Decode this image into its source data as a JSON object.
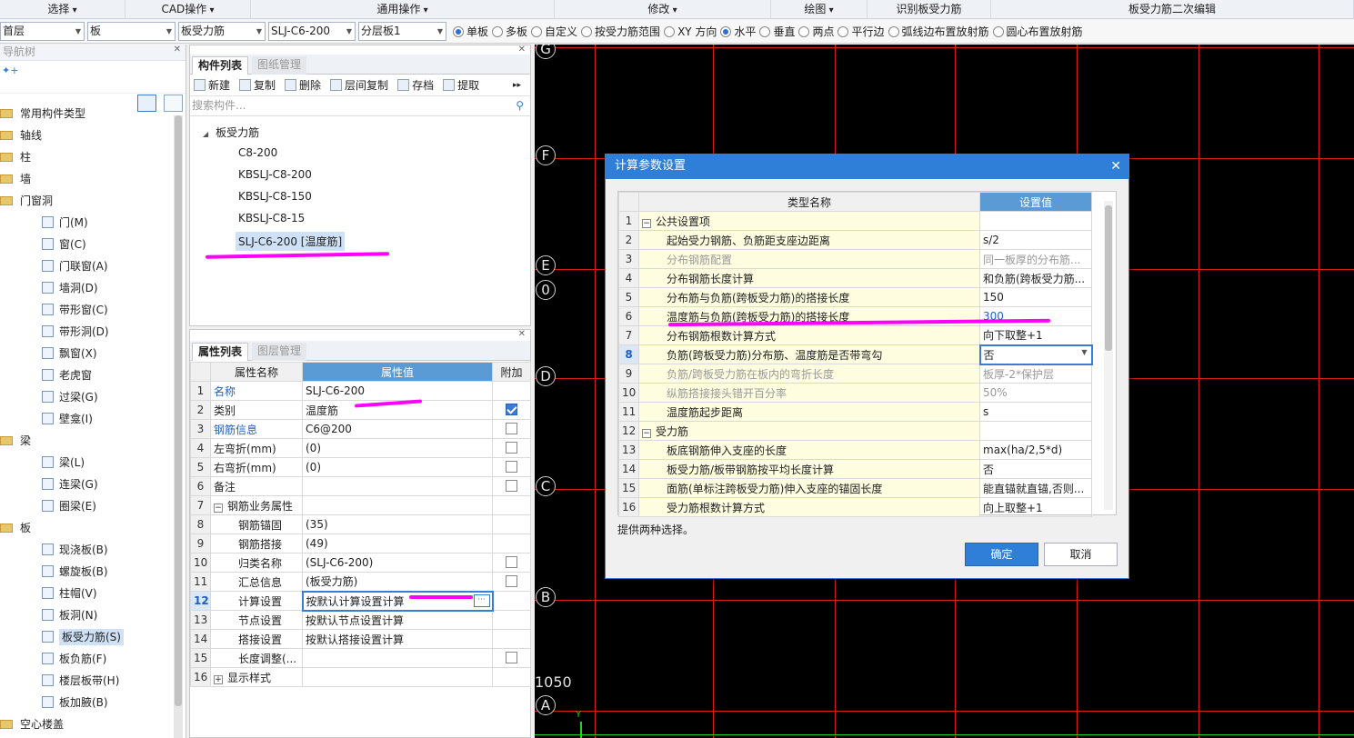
{
  "menu": [
    {
      "label": "选择",
      "w": 138
    },
    {
      "label": "CAD操作",
      "w": 138
    },
    {
      "label": "通用操作",
      "w": 334
    },
    {
      "label": "修改",
      "w": 238
    },
    {
      "label": "绘图",
      "w": 106
    },
    {
      "label": "识别板受力筋",
      "w": 136
    },
    {
      "label": "板受力筋二次编辑",
      "w": 399
    }
  ],
  "options": {
    "combos": [
      {
        "v": "首层",
        "w": 93
      },
      {
        "v": "板",
        "w": 97
      },
      {
        "v": "板受力筋",
        "w": 96
      },
      {
        "v": "SLJ-C6-200",
        "w": 96
      },
      {
        "v": "分层板1",
        "w": 97
      }
    ],
    "radios": [
      {
        "label": "单板",
        "on": true
      },
      {
        "label": "多板",
        "on": false
      },
      {
        "label": "自定义",
        "on": false
      },
      {
        "label": "按受力筋范围",
        "on": false
      },
      {
        "label": "XY 方向",
        "on": false
      },
      {
        "label": "水平",
        "on": true
      },
      {
        "label": "垂直",
        "on": false
      },
      {
        "label": "两点",
        "on": false
      },
      {
        "label": "平行边",
        "on": false
      },
      {
        "label": "弧线边布置放射筋",
        "on": false
      },
      {
        "label": "圆心布置放射筋",
        "on": false
      }
    ]
  },
  "nav": {
    "title": "导航树",
    "items": [
      {
        "label": "常用构件类型",
        "lvl": 0,
        "folder": true
      },
      {
        "label": "轴线",
        "lvl": 0,
        "folder": true
      },
      {
        "label": "柱",
        "lvl": 0,
        "folder": true
      },
      {
        "label": "墙",
        "lvl": 0,
        "folder": true
      },
      {
        "label": "门窗洞",
        "lvl": 0,
        "folder": true
      },
      {
        "label": "门(M)",
        "lvl": 1
      },
      {
        "label": "窗(C)",
        "lvl": 1
      },
      {
        "label": "门联窗(A)",
        "lvl": 1
      },
      {
        "label": "墙洞(D)",
        "lvl": 1
      },
      {
        "label": "带形窗(C)",
        "lvl": 1
      },
      {
        "label": "带形洞(D)",
        "lvl": 1
      },
      {
        "label": "飘窗(X)",
        "lvl": 1
      },
      {
        "label": "老虎窗",
        "lvl": 1
      },
      {
        "label": "过梁(G)",
        "lvl": 1
      },
      {
        "label": "壁龛(I)",
        "lvl": 1
      },
      {
        "label": "梁",
        "lvl": 0,
        "folder": true
      },
      {
        "label": "梁(L)",
        "lvl": 1
      },
      {
        "label": "连梁(G)",
        "lvl": 1
      },
      {
        "label": "圈梁(E)",
        "lvl": 1
      },
      {
        "label": "板",
        "lvl": 0,
        "folder": true
      },
      {
        "label": "现浇板(B)",
        "lvl": 1
      },
      {
        "label": "螺旋板(B)",
        "lvl": 1
      },
      {
        "label": "柱帽(V)",
        "lvl": 1
      },
      {
        "label": "板洞(N)",
        "lvl": 1
      },
      {
        "label": "板受力筋(S)",
        "lvl": 1,
        "sel": true
      },
      {
        "label": "板负筋(F)",
        "lvl": 1
      },
      {
        "label": "楼层板带(H)",
        "lvl": 1
      },
      {
        "label": "板加腋(B)",
        "lvl": 1
      },
      {
        "label": "空心楼盖",
        "lvl": 0,
        "folder": true
      }
    ]
  },
  "comp": {
    "tab_active": "构件列表",
    "tab_other": "图纸管理",
    "toolbar": [
      "新建",
      "复制",
      "删除",
      "层间复制",
      "存档",
      "提取"
    ],
    "search_placeholder": "搜索构件...",
    "group": "板受力筋",
    "items": [
      "C8-200",
      "KBSLJ-C8-200",
      "KBSLJ-C8-150",
      "KBSLJ-C8-15",
      "SLJ-C6-200 [温度筋]"
    ]
  },
  "prop": {
    "tab_active": "属性列表",
    "tab_other": "图层管理",
    "headers": [
      "属性名称",
      "属性值",
      "附加"
    ],
    "rows": [
      {
        "n": "1",
        "name": "名称",
        "val": "SLJ-C6-200",
        "blue": true,
        "chk": null
      },
      {
        "n": "2",
        "name": "类别",
        "val": "温度筋",
        "chk": "on"
      },
      {
        "n": "3",
        "name": "钢筋信息",
        "val": "C6@200",
        "blue": true,
        "chk": "off"
      },
      {
        "n": "4",
        "name": "左弯折(mm)",
        "val": "(0)",
        "chk": "off"
      },
      {
        "n": "5",
        "name": "右弯折(mm)",
        "val": "(0)",
        "chk": "off"
      },
      {
        "n": "6",
        "name": "备注",
        "val": "",
        "chk": "off"
      },
      {
        "n": "7",
        "name": "钢筋业务属性",
        "val": "",
        "group": "minus",
        "chk": null
      },
      {
        "n": "8",
        "name": "钢筋锚固",
        "val": "(35)",
        "ind": true,
        "chk": null
      },
      {
        "n": "9",
        "name": "钢筋搭接",
        "val": "(49)",
        "ind": true,
        "chk": null
      },
      {
        "n": "10",
        "name": "归类名称",
        "val": "(SLJ-C6-200)",
        "ind": true,
        "chk": "off"
      },
      {
        "n": "11",
        "name": "汇总信息",
        "val": "(板受力筋)",
        "ind": true,
        "chk": "off"
      },
      {
        "n": "12",
        "name": "计算设置",
        "val": "按默认计算设置计算",
        "ind": true,
        "cur": true,
        "chk": null
      },
      {
        "n": "13",
        "name": "节点设置",
        "val": "按默认节点设置计算",
        "ind": true,
        "chk": null
      },
      {
        "n": "14",
        "name": "搭接设置",
        "val": "按默认搭接设置计算",
        "ind": true,
        "chk": null
      },
      {
        "n": "15",
        "name": "长度调整(...",
        "val": "",
        "ind": true,
        "chk": "off"
      },
      {
        "n": "16",
        "name": "显示样式",
        "val": "",
        "group": "plus",
        "chk": null
      }
    ]
  },
  "cad": {
    "axes": [
      "G",
      "F",
      "E",
      "0",
      "D",
      "C",
      "B",
      "A"
    ],
    "label": "1050",
    "y_axis": "Y"
  },
  "dialog": {
    "title": "计算参数设置",
    "headers": [
      "类型名称",
      "设置值"
    ],
    "rows": [
      {
        "n": "1",
        "name": "公共设置项",
        "val": "",
        "group": true
      },
      {
        "n": "2",
        "name": "起始受力钢筋、负筋距支座边距离",
        "val": "s/2"
      },
      {
        "n": "3",
        "name": "分布钢筋配置",
        "val": "同一板厚的分布筋...",
        "grey": true
      },
      {
        "n": "4",
        "name": "分布钢筋长度计算",
        "val": "和负筋(跨板受力筋..."
      },
      {
        "n": "5",
        "name": "分布筋与负筋(跨板受力筋)的搭接长度",
        "val": "150"
      },
      {
        "n": "6",
        "name": "温度筋与负筋(跨板受力筋)的搭接长度",
        "val": "300",
        "blue": true
      },
      {
        "n": "7",
        "name": "分布钢筋根数计算方式",
        "val": "向下取整+1"
      },
      {
        "n": "8",
        "name": "负筋(跨板受力筋)分布筋、温度筋是否带弯勾",
        "val": "否",
        "cur": true
      },
      {
        "n": "9",
        "name": "负筋/跨板受力筋在板内的弯折长度",
        "val": "板厚-2*保护层",
        "grey": true
      },
      {
        "n": "10",
        "name": "纵筋搭接接头错开百分率",
        "val": "50%",
        "grey": true
      },
      {
        "n": "11",
        "name": "温度筋起步距离",
        "val": "s"
      },
      {
        "n": "12",
        "name": "受力筋",
        "val": "",
        "group": true
      },
      {
        "n": "13",
        "name": "板底钢筋伸入支座的长度",
        "val": "max(ha/2,5*d)"
      },
      {
        "n": "14",
        "name": "板受力筋/板带钢筋按平均长度计算",
        "val": "否"
      },
      {
        "n": "15",
        "name": "面筋(单标注跨板受力筋)伸入支座的锚固长度",
        "val": "能直锚就直锚,否则..."
      },
      {
        "n": "16",
        "name": "受力筋根数计算方式",
        "val": "向上取整+1"
      }
    ],
    "hint": "提供两种选择。",
    "ok": "确定",
    "cancel": "取消"
  }
}
